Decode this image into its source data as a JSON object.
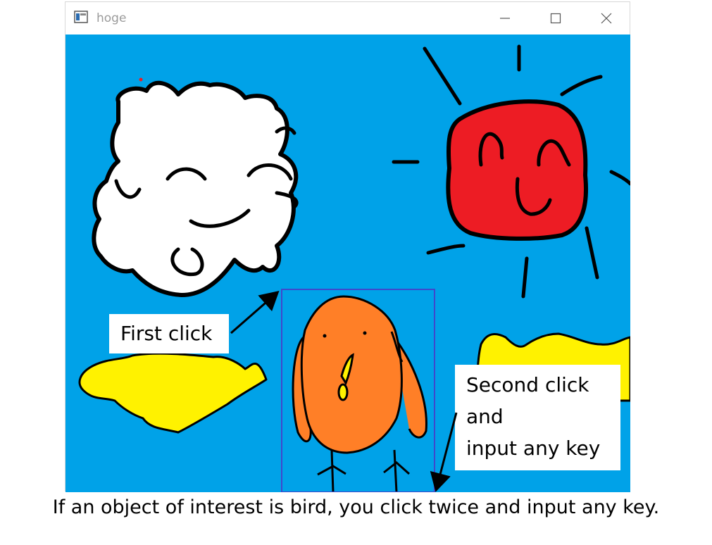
{
  "window": {
    "title": "hoge",
    "minimize_label": "minimize",
    "maximize_label": "maximize",
    "close_label": "close"
  },
  "annotations": {
    "first_click": "First click",
    "second_click_lines": [
      "Second click",
      "and",
      "input any key"
    ]
  },
  "caption": "If an object of interest is bird, you click twice and input any key.",
  "colors": {
    "sky": "#00a2e8",
    "sun": "#ed1c24",
    "bird": "#ff7f27",
    "beak": "#fff200",
    "bush": "#fff200",
    "cloud": "#ffffff",
    "selection_box": "#3f48cc"
  },
  "icons": {
    "app": "app-window-icon",
    "minimize": "minimize-icon",
    "maximize": "maximize-icon",
    "close": "close-icon"
  }
}
